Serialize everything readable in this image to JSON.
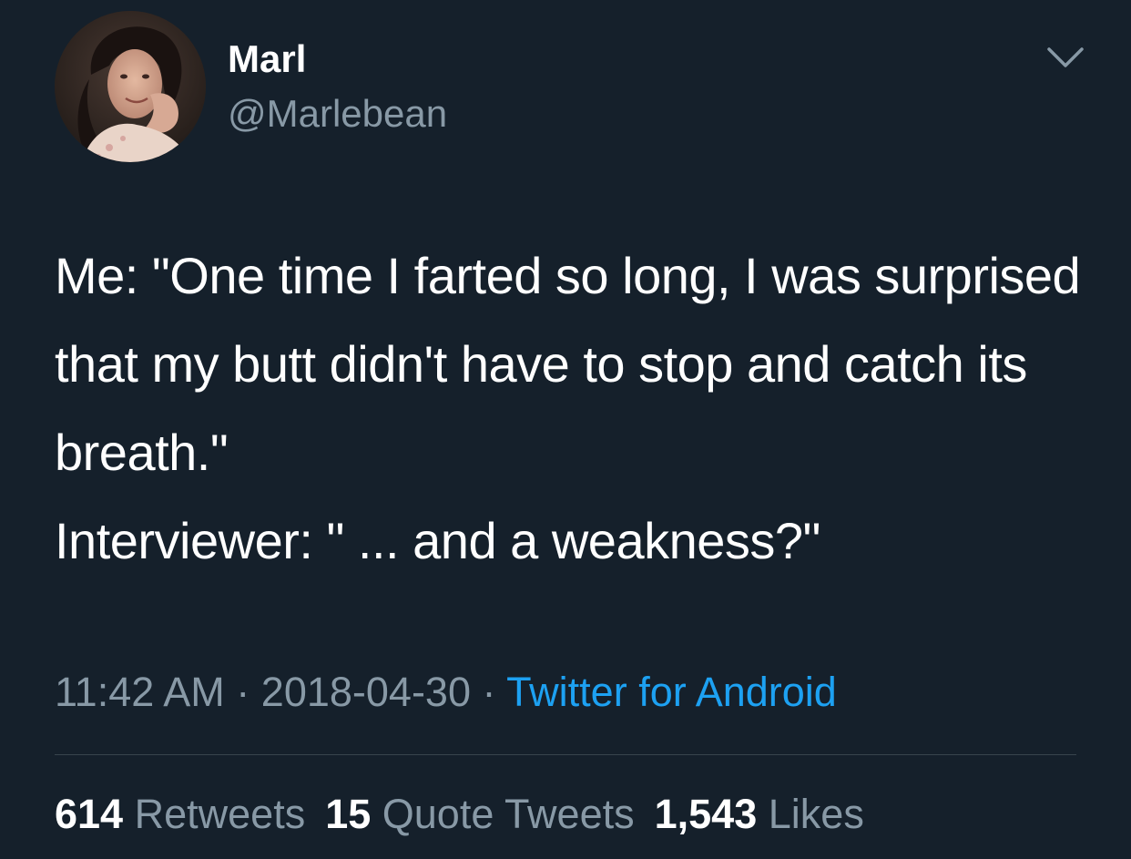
{
  "user": {
    "display_name": "Marl",
    "handle": "@Marlebean"
  },
  "icons": {
    "menu": "chevron-down-icon",
    "avatar": "profile-photo"
  },
  "tweet": {
    "line1": "Me: \"One time I farted so long, I was surprised that my butt didn't have to stop and catch its breath.\"",
    "line2": "Interviewer: \" ... and a weakness?\""
  },
  "meta": {
    "time": "11:42 AM",
    "separator1": " · ",
    "date": "2018-04-30",
    "separator2": " · ",
    "source": "Twitter for Android"
  },
  "stats": {
    "retweets_count": "614",
    "retweets_label": "Retweets",
    "quotes_count": "15",
    "quotes_label": "Quote Tweets",
    "likes_count": "1,543",
    "likes_label": "Likes"
  },
  "colors": {
    "background": "#15202b",
    "text": "#ffffff",
    "secondary": "#8899a6",
    "link": "#1da1f2",
    "divider": "#38444d"
  }
}
